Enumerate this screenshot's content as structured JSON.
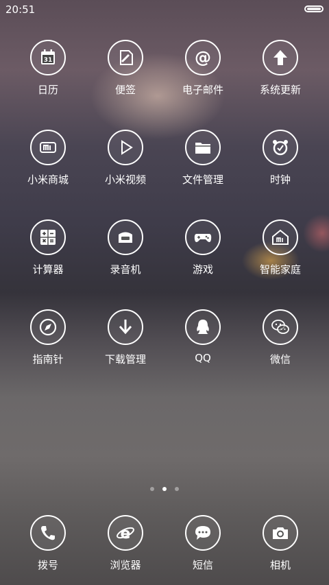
{
  "status_bar": {
    "time": "20:51"
  },
  "calendar_day": "31",
  "apps": [
    {
      "label": "日历",
      "icon": "calendar-icon"
    },
    {
      "label": "便签",
      "icon": "notes-icon"
    },
    {
      "label": "电子邮件",
      "icon": "email-icon"
    },
    {
      "label": "系统更新",
      "icon": "update-icon"
    },
    {
      "label": "小米商城",
      "icon": "mi-store-icon"
    },
    {
      "label": "小米视频",
      "icon": "video-icon"
    },
    {
      "label": "文件管理",
      "icon": "folder-icon"
    },
    {
      "label": "时钟",
      "icon": "clock-icon"
    },
    {
      "label": "计算器",
      "icon": "calculator-icon"
    },
    {
      "label": "录音机",
      "icon": "recorder-icon"
    },
    {
      "label": "游戏",
      "icon": "gamepad-icon"
    },
    {
      "label": "智能家庭",
      "icon": "smart-home-icon"
    },
    {
      "label": "指南针",
      "icon": "compass-icon"
    },
    {
      "label": "下载管理",
      "icon": "download-icon"
    },
    {
      "label": "QQ",
      "icon": "qq-icon"
    },
    {
      "label": "微信",
      "icon": "wechat-icon"
    }
  ],
  "page_indicator": {
    "count": 3,
    "active": 2
  },
  "dock": [
    {
      "label": "拨号",
      "icon": "phone-icon"
    },
    {
      "label": "浏览器",
      "icon": "browser-icon"
    },
    {
      "label": "短信",
      "icon": "sms-icon"
    },
    {
      "label": "相机",
      "icon": "camera-icon"
    }
  ]
}
